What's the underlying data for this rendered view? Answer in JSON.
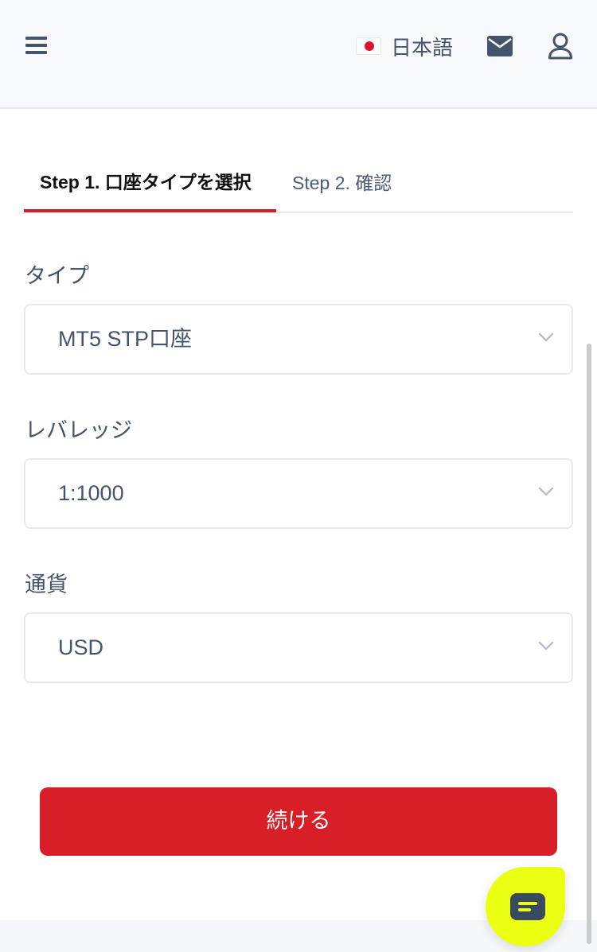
{
  "header": {
    "language_label": "日本語",
    "icons": [
      "menu-icon",
      "japan-flag-icon",
      "mail-icon",
      "user-icon"
    ]
  },
  "tabs": [
    {
      "label": "Step 1. 口座タイプを選択",
      "active": true
    },
    {
      "label": "Step 2. 確認",
      "active": false
    }
  ],
  "form": {
    "type": {
      "label": "タイプ",
      "value": "MT5 STP口座"
    },
    "leverage": {
      "label": "レバレッジ",
      "value": "1:1000"
    },
    "currency": {
      "label": "通貨",
      "value": "USD"
    }
  },
  "continue_label": "続ける",
  "colors": {
    "accent": "#d81e27",
    "chat_button": "#eaff12",
    "header_bg": "#f8f9fc",
    "text": "#44546a"
  }
}
